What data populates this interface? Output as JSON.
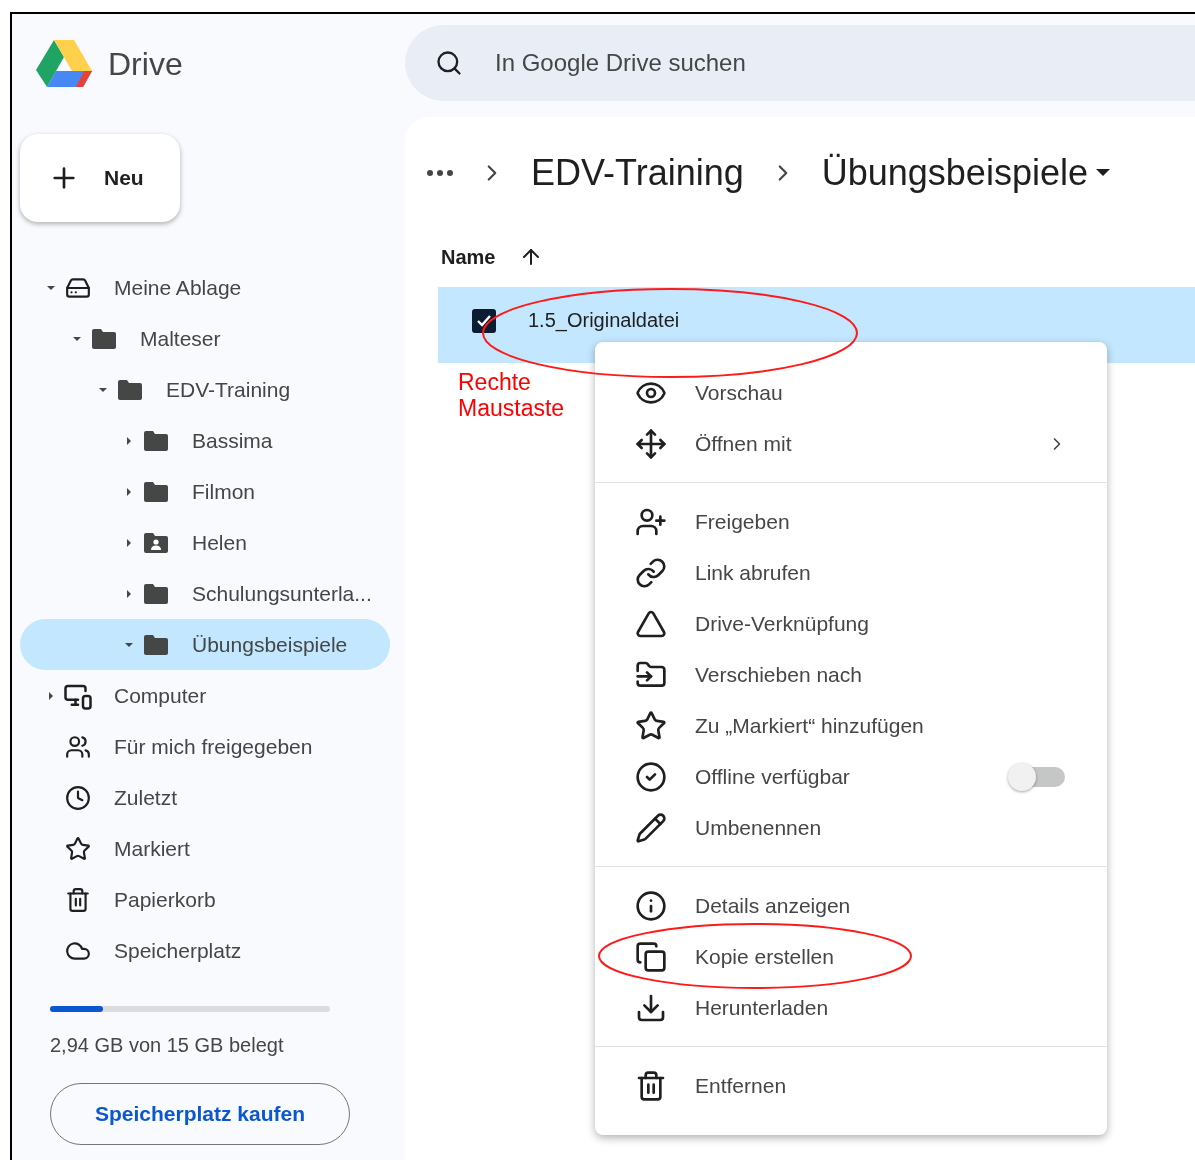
{
  "app": {
    "title": "Drive"
  },
  "search": {
    "placeholder": "In Google Drive suchen"
  },
  "new_button": {
    "label": "Neu"
  },
  "tree": [
    {
      "label": "Meine Ablage",
      "kind": "drive",
      "expanded": true,
      "selected": false,
      "children": [
        {
          "label": "Malteser",
          "kind": "folder",
          "expanded": true,
          "selected": false,
          "children": [
            {
              "label": "EDV-Training",
              "kind": "folder",
              "expanded": true,
              "selected": false,
              "children": [
                {
                  "label": "Bassima",
                  "kind": "folder",
                  "expanded": false,
                  "selected": false
                },
                {
                  "label": "Filmon",
                  "kind": "folder",
                  "expanded": false,
                  "selected": false
                },
                {
                  "label": "Helen",
                  "kind": "shared_folder",
                  "expanded": false,
                  "selected": false
                },
                {
                  "label": "Schulungsunterla...",
                  "kind": "folder",
                  "expanded": false,
                  "selected": false
                },
                {
                  "label": "Übungsbeispiele",
                  "kind": "folder",
                  "expanded": true,
                  "selected": true
                }
              ]
            }
          ]
        }
      ]
    },
    {
      "label": "Computer",
      "kind": "computer",
      "expanded": false,
      "selected": false
    }
  ],
  "nav": [
    {
      "label": "Für mich freigegeben"
    },
    {
      "label": "Zuletzt"
    },
    {
      "label": "Markiert"
    },
    {
      "label": "Papierkorb"
    },
    {
      "label": "Speicherplatz"
    }
  ],
  "storage": {
    "level": 0.19,
    "text": "2,94 GB von 15 GB belegt",
    "button": "Speicherplatz kaufen"
  },
  "breadcrumb": [
    "EDV-Training",
    "Übungsbeispiele"
  ],
  "table": {
    "columns": [
      {
        "label": "Name"
      }
    ],
    "rows": [
      {
        "name": "1.5_Originaldatei",
        "selected": true,
        "checked": true,
        "circled": true
      }
    ]
  },
  "annotation": {
    "text": "Rechte Maustaste"
  },
  "context_menu": {
    "groups": [
      [
        {
          "label": "Vorschau",
          "circled": false
        },
        {
          "label": "Öffnen mit",
          "submenu": true,
          "circled": false
        }
      ],
      [
        {
          "label": "Freigeben",
          "circled": false
        },
        {
          "label": "Link abrufen",
          "circled": false
        },
        {
          "label": "Drive-Verknüpfung",
          "circled": false
        },
        {
          "label": "Verschieben nach",
          "circled": false
        },
        {
          "label": "Zu „Markiert“ hinzufügen",
          "circled": false
        },
        {
          "label": "Offline verfügbar",
          "toggle": {
            "on": false
          },
          "circled": false
        },
        {
          "label": "Umbenennen",
          "circled": false
        }
      ],
      [
        {
          "label": "Details anzeigen",
          "circled": false
        },
        {
          "label": "Kopie erstellen",
          "circled": true
        },
        {
          "label": "Herunterladen",
          "circled": false
        }
      ],
      [
        {
          "label": "Entfernen",
          "circled": false
        }
      ]
    ]
  }
}
